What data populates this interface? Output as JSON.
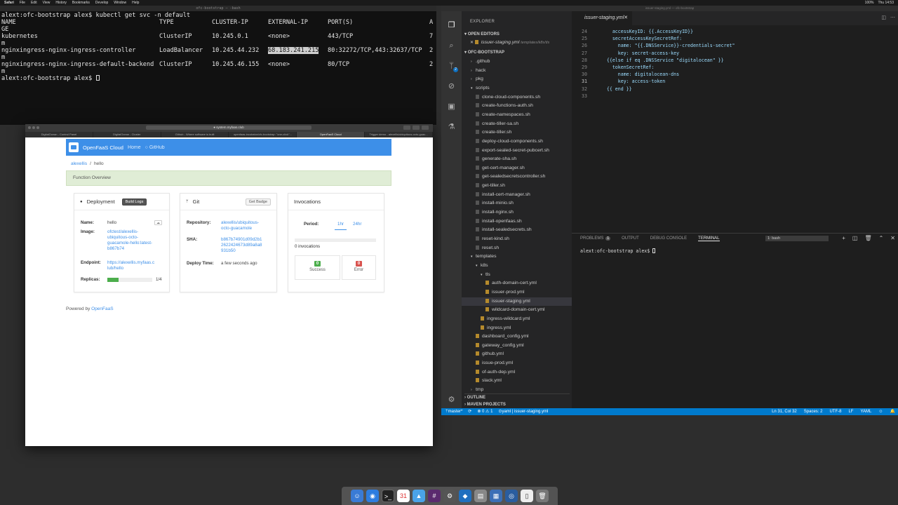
{
  "menubar": {
    "items": [
      "Safari",
      "File",
      "Edit",
      "View",
      "History",
      "Bookmarks",
      "Develop",
      "Window",
      "Help"
    ],
    "right": [
      "100%",
      "Thu 14:53"
    ]
  },
  "terminal": {
    "title": "ofc-bootstrap — -bash",
    "prompt_cmd": "alext:ofc-bootstrap alex$ kubectl get svc -n default",
    "headers": [
      "NAME",
      "TYPE",
      "CLUSTER-IP",
      "EXTERNAL-IP",
      "PORT(S)",
      "A"
    ],
    "header_wrap": "GE",
    "rows": [
      {
        "name": "kubernetes",
        "type": "ClusterIP",
        "cip": "10.245.0.1",
        "eip": "<none>",
        "ports": "443/TCP",
        "age": "7",
        "wrap": "m"
      },
      {
        "name": "nginxingress-nginx-ingress-controller",
        "type": "LoadBalancer",
        "cip": "10.245.44.232",
        "eip": "68.183.241.215",
        "ports": "80:32272/TCP,443:32637/TCP",
        "age": "2",
        "wrap": "m"
      },
      {
        "name": "nginxingress-nginx-ingress-default-backend",
        "type": "ClusterIP",
        "cip": "10.245.46.155",
        "eip": "<none>",
        "ports": "80/TCP",
        "age": "2",
        "wrap": "m"
      }
    ],
    "prompt_end": "alext:ofc-bootstrap alex$ "
  },
  "safari": {
    "url": "● system.myfaas.club",
    "tabs": [
      "DigitalOcean - Control Panel",
      "DigitalOcean - Cluster",
      "Github - Where software is built",
      "openfaas-incubator/ofc-bootstrap: \"one-click\"...",
      "OpenFaaS Cloud",
      "Trigger demo - alexellis/ubiquitous-octo-guac..."
    ],
    "nav": {
      "brand": "OpenFaaS Cloud",
      "home": "Home",
      "github": "GitHub"
    },
    "breadcrumb": {
      "user": "alexellis",
      "sep": "/",
      "fn": "hello"
    },
    "overview": "Function Overview",
    "deployment": {
      "title": "Deployment",
      "build_logs": "Build Logs",
      "name_k": "Name:",
      "name_v": "hello",
      "image_k": "Image:",
      "image_v": [
        "ofctest/alexellis-",
        "ubiquitous-octo-",
        "guacamole-hello:latest-",
        "b867b74"
      ],
      "endpoint_k": "Endpoint:",
      "endpoint_v": [
        "https://alexellis.myfaas.c",
        "lub/hello"
      ],
      "replicas_k": "Replicas:",
      "replicas_v": "1/4",
      "replicas_fraction": 0.25
    },
    "git": {
      "title": "Git",
      "badge": "Get Badge",
      "repo_k": "Repository:",
      "repo_v": [
        "alexellis/ubiquitous-",
        "octo-guacamole"
      ],
      "sha_k": "SHA:",
      "sha_v": [
        "b867b74901d09d2b1",
        "2622424673d89a8a8",
        "931b50"
      ],
      "time_k": "Deploy Time:",
      "time_v": "a few seconds ago"
    },
    "invocations": {
      "title": "Invocations",
      "period_k": "Period:",
      "p1": "1hr",
      "p2": "24hr",
      "count": "0 invocations",
      "success_n": "0",
      "success_l": "Success",
      "error_n": "0",
      "error_l": "Error"
    },
    "powered": {
      "text": "Powered by",
      "link": "OpenFaaS"
    }
  },
  "vscode": {
    "title": "issuer-staging.yml — ofc-bootstrap",
    "explorer_title": "EXPLORER",
    "open_editors": "OPEN EDITORS",
    "open_file": "issuer-staging.yml",
    "open_path": "templates/k8s/tls",
    "project": "OFC-BOOTSTRAP",
    "tree": [
      {
        "label": ".github",
        "depth": 1,
        "kind": "folder"
      },
      {
        "label": "hack",
        "depth": 1,
        "kind": "folder"
      },
      {
        "label": "pkg",
        "depth": 1,
        "kind": "folder"
      },
      {
        "label": "scripts",
        "depth": 1,
        "kind": "folder-open"
      },
      {
        "label": "clone-cloud-components.sh",
        "depth": 2,
        "kind": "file"
      },
      {
        "label": "create-functions-auth.sh",
        "depth": 2,
        "kind": "file"
      },
      {
        "label": "create-namespaces.sh",
        "depth": 2,
        "kind": "file"
      },
      {
        "label": "create-tiller-sa.sh",
        "depth": 2,
        "kind": "file"
      },
      {
        "label": "create-tiller.sh",
        "depth": 2,
        "kind": "file"
      },
      {
        "label": "deploy-cloud-components.sh",
        "depth": 2,
        "kind": "file"
      },
      {
        "label": "export-sealed-secret-pubcert.sh",
        "depth": 2,
        "kind": "file"
      },
      {
        "label": "generate-sha.sh",
        "depth": 2,
        "kind": "file"
      },
      {
        "label": "get-cert-manager.sh",
        "depth": 2,
        "kind": "file"
      },
      {
        "label": "get-sealedsecretscontroller.sh",
        "depth": 2,
        "kind": "file"
      },
      {
        "label": "get-tiller.sh",
        "depth": 2,
        "kind": "file"
      },
      {
        "label": "install-cert-manager.sh",
        "depth": 2,
        "kind": "file"
      },
      {
        "label": "install-minio.sh",
        "depth": 2,
        "kind": "file"
      },
      {
        "label": "install-nginx.sh",
        "depth": 2,
        "kind": "file"
      },
      {
        "label": "install-openfaas.sh",
        "depth": 2,
        "kind": "file"
      },
      {
        "label": "install-sealedsecrets.sh",
        "depth": 2,
        "kind": "file"
      },
      {
        "label": "reset-kind.sh",
        "depth": 2,
        "kind": "file"
      },
      {
        "label": "reset.sh",
        "depth": 2,
        "kind": "file"
      },
      {
        "label": "templates",
        "depth": 1,
        "kind": "folder-open"
      },
      {
        "label": "k8s",
        "depth": 2,
        "kind": "folder-open"
      },
      {
        "label": "tls",
        "depth": 3,
        "kind": "folder-open"
      },
      {
        "label": "auth-domain-cert.yml",
        "depth": 4,
        "kind": "yml"
      },
      {
        "label": "issuer-prod.yml",
        "depth": 4,
        "kind": "yml"
      },
      {
        "label": "issuer-staging.yml",
        "depth": 4,
        "kind": "yml",
        "selected": true
      },
      {
        "label": "wildcard-domain-cert.yml",
        "depth": 4,
        "kind": "yml"
      },
      {
        "label": "ingress-wildcard.yml",
        "depth": 3,
        "kind": "yml"
      },
      {
        "label": "ingress.yml",
        "depth": 3,
        "kind": "yml"
      },
      {
        "label": "dashboard_config.yml",
        "depth": 2,
        "kind": "yml"
      },
      {
        "label": "gateway_config.yml",
        "depth": 2,
        "kind": "yml"
      },
      {
        "label": "github.yml",
        "depth": 2,
        "kind": "yml"
      },
      {
        "label": "issue-prod.yml",
        "depth": 2,
        "kind": "yml"
      },
      {
        "label": "of-auth-dep.yml",
        "depth": 2,
        "kind": "yml"
      },
      {
        "label": "slack.yml",
        "depth": 2,
        "kind": "yml"
      },
      {
        "label": "tmp",
        "depth": 1,
        "kind": "folder"
      }
    ],
    "outline": "OUTLINE",
    "maven": "MAVEN PROJECTS",
    "tab": "issuer-staging.yml",
    "code": [
      {
        "n": "24",
        "text": "      accessKeyID: {{.AccessKeyID}}"
      },
      {
        "n": "25",
        "text": "      secretAccessKeySecretRef:"
      },
      {
        "n": "26",
        "text": "        name: \"{{.DNSService}}-credentials-secret\""
      },
      {
        "n": "27",
        "text": "        key: secret-access-key"
      },
      {
        "n": "28",
        "text": "    {{else if eq .DNSService \"digitalocean\" }}"
      },
      {
        "n": "29",
        "text": "      tokenSecretRef:"
      },
      {
        "n": "30",
        "text": "        name: digitalocean-dns"
      },
      {
        "n": "31",
        "text": "        key: access-token"
      },
      {
        "n": "32",
        "text": "    {{ end }}"
      },
      {
        "n": "33",
        "text": ""
      }
    ],
    "panel_tabs": {
      "problems": "PROBLEMS",
      "problems_count": "1",
      "output": "OUTPUT",
      "debug": "DEBUG CONSOLE",
      "terminal": "TERMINAL"
    },
    "shell": "1: bash",
    "term_line": "alext:ofc-bootstrap alex$ ",
    "status": {
      "branch": "master*",
      "errors": "0",
      "warnings": "1",
      "lang_file": "yaml",
      "file": "issuer-staging.yml",
      "pos": "Ln 31, Col 32",
      "spaces": "Spaces: 2",
      "enc": "UTF-8",
      "eol": "LF",
      "mode": "YAML"
    }
  },
  "colors": {
    "openfaas_blue": "#3d8fe8",
    "vscode_blue": "#007acc",
    "success": "#4cae4c",
    "error": "#d9534f"
  }
}
